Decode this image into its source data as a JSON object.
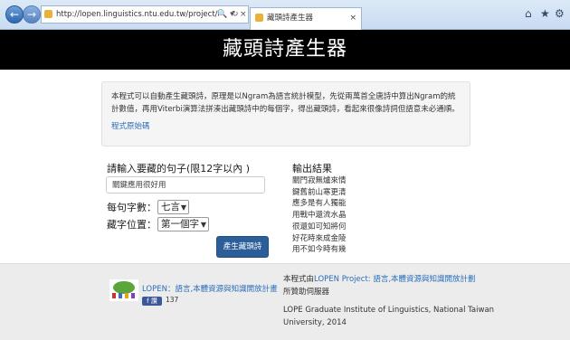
{
  "browser": {
    "url": "http://lopen.linguistics.ntu.edu.tw/project/acrosticpoem",
    "tab_title": "藏頭詩產生器",
    "tab_close": "×",
    "search_ctrl": "🔍 ▾",
    "refresh_ctrl": "↻",
    "close_ctrl": "×"
  },
  "header": {
    "title": "藏頭詩產生器"
  },
  "intro": {
    "description": "本程式可以自動產生藏頭詩，原理是以Ngram為語言統計模型，先從兩萬首全唐詩中算出Ngram的統計數值，再用Viterbi演算法拼湊出藏頭詩中的每個字，得出藏頭詩，看起來很像詩詞但語意未必通順。",
    "source_link": "程式原始碼"
  },
  "form": {
    "prompt": "請輸入要藏的句子(限12字以內 )",
    "input_value": "關鍵應用很好用",
    "chars_label": "每句字數：",
    "chars_value": "七言",
    "position_label": "藏字位置：",
    "position_value": "第一個字",
    "submit_label": "產生藏頭詩"
  },
  "output": {
    "title": "輸出結果",
    "lines": [
      "關門寂無爐來情",
      "鍵舊前山寒更清",
      "應多是有人獨能",
      "用戰中還流水晶",
      "很還如可知將何",
      "好花時來成金陵",
      "用不如今時有幾"
    ]
  },
  "footer": {
    "lope_name": "LOPEN：語言,本體資源與知識開放計畫",
    "fb_label": "f 讚",
    "fb_count": "137",
    "credit_prefix": "本程式由",
    "credit_link": "LOPEN Project: 語言,本體資源與知識開放計劃",
    "credit_suffix": "所贊助伺服器",
    "institution": "LOPE Graduate Institute of Linguistics, National Taiwan University, 2014"
  },
  "icons": {
    "back": "←",
    "forward": "→",
    "home": "⌂",
    "favorites": "★",
    "settings": "⚙"
  },
  "colors": {
    "header_bg": "#000000",
    "button_bg": "#2c5f99",
    "link": "#2a6ebb",
    "footer_bg": "#ececec"
  }
}
